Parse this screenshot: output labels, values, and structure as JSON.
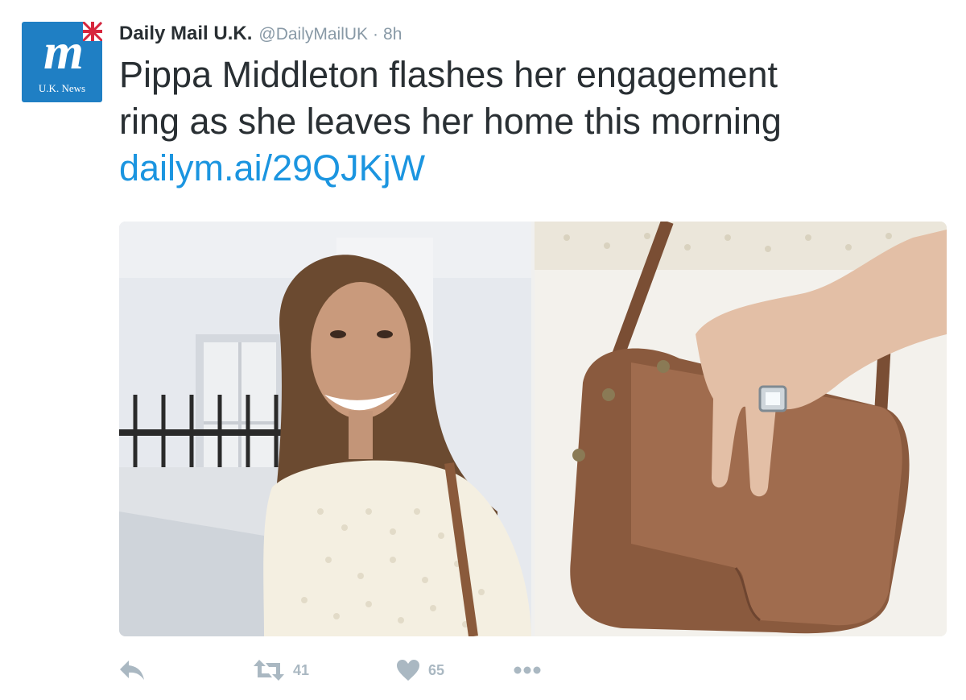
{
  "account": {
    "display_name": "Daily Mail U.K.",
    "handle": "@DailyMailUK",
    "separator": "·",
    "timestamp": "8h",
    "avatar": {
      "logo_text": "m",
      "badge_text": "U.K. News",
      "brand_color": "#1f7fc4"
    }
  },
  "tweet": {
    "text_lines": [
      "Pippa Middleton flashes her engagement",
      "ring as she leaves her home this morning"
    ],
    "link": "dailym.ai/29QJKjW",
    "link_color": "#1b95e0"
  },
  "media": {
    "photos": [
      {
        "icon": "portrait-photo"
      },
      {
        "icon": "handbag-ring-photo"
      }
    ]
  },
  "actions": {
    "reply": {
      "icon": "reply-icon"
    },
    "retweet": {
      "icon": "retweet-icon",
      "count": "41"
    },
    "like": {
      "icon": "heart-icon",
      "count": "65"
    },
    "more": {
      "icon": "more-icon"
    },
    "icon_color": "#aab8c2"
  }
}
